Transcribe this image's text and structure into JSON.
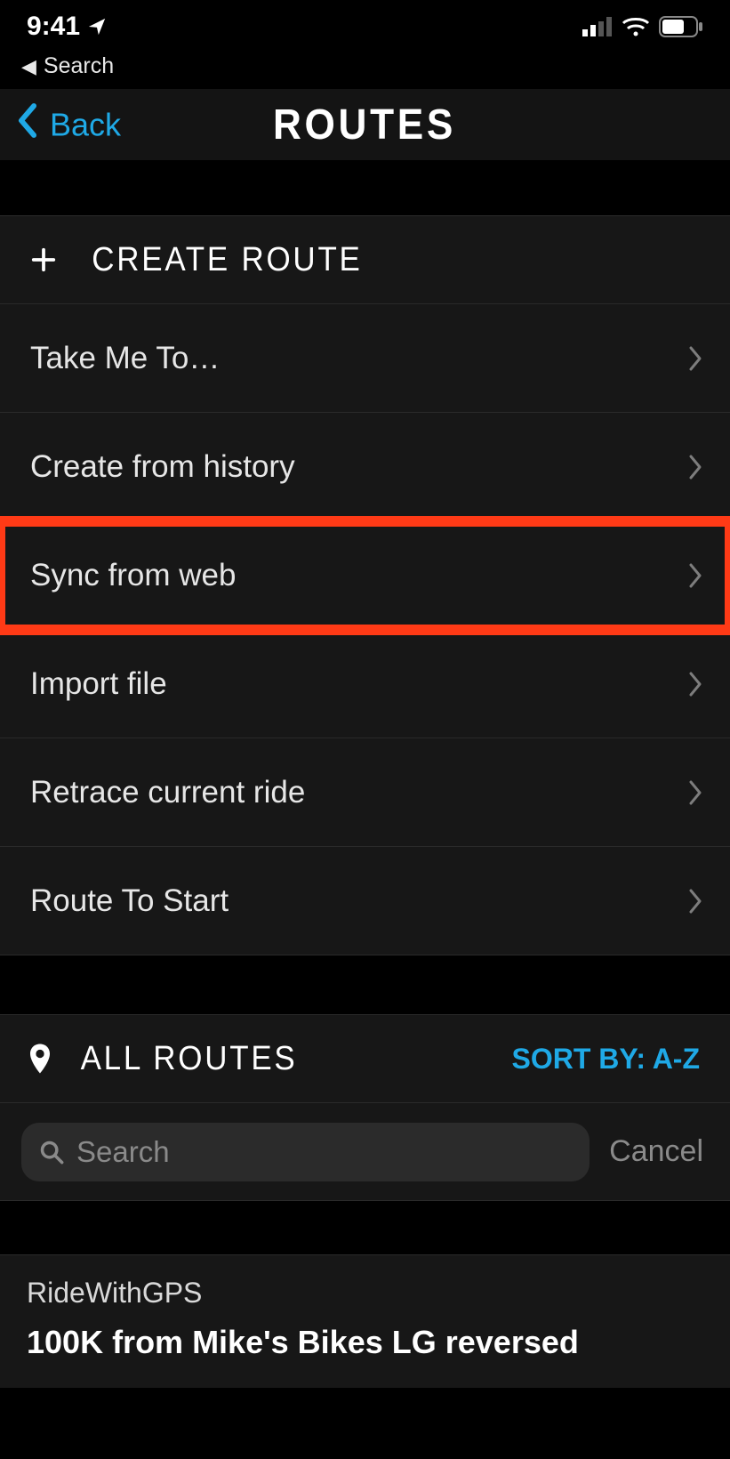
{
  "status_bar": {
    "time": "9:41",
    "breadcrumb_label": "Search"
  },
  "nav": {
    "back_label": "Back",
    "title": "ROUTES"
  },
  "create_section": {
    "header": "CREATE ROUTE",
    "items": [
      {
        "label": "Take Me To…"
      },
      {
        "label": "Create from history"
      },
      {
        "label": "Sync from web",
        "highlighted": true
      },
      {
        "label": "Import file"
      },
      {
        "label": "Retrace current ride"
      },
      {
        "label": "Route To Start"
      }
    ]
  },
  "all_routes": {
    "header": "ALL ROUTES",
    "sort_label": "SORT BY: A-Z"
  },
  "search": {
    "placeholder": "Search",
    "cancel_label": "Cancel"
  },
  "routes_list": [
    {
      "source": "RideWithGPS",
      "title": "100K from Mike's Bikes LG reversed"
    }
  ]
}
